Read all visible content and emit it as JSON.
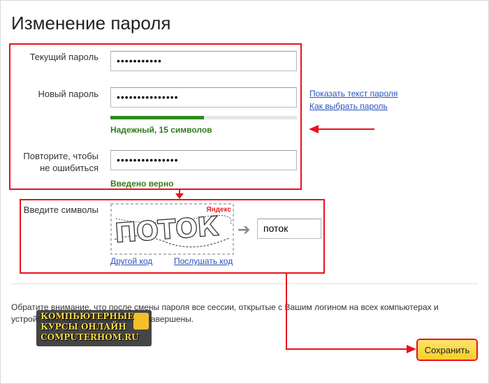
{
  "page": {
    "title": "Изменение пароля"
  },
  "form": {
    "current_password": {
      "label": "Текущий пароль",
      "value": "•••••••••••"
    },
    "new_password": {
      "label": "Новый пароль",
      "value": "•••••••••••••••"
    },
    "strength": {
      "level": 0.5,
      "text": "Надежный, 15 символов"
    },
    "repeat_password": {
      "label": "Повторите, чтобы не ошибиться",
      "value": "•••••••••••••••",
      "status": "Введено верно"
    }
  },
  "side_links": {
    "show_password": "Показать текст пароля",
    "how_to_choose": "Как выбрать пароль"
  },
  "captcha": {
    "label": "Введите символы",
    "image_word": "ПОТОК",
    "brand": "Яндекс",
    "input_value": "поток",
    "other_code": "Другой код",
    "listen_code": "Послушать код"
  },
  "notice": "Обратите внимание, что после смены пароля все сессии, открытые с Вашим логином на всех компьютерах и устройствах, будут автоматически завершены.",
  "actions": {
    "save_label": "Сохранить"
  },
  "watermark": {
    "line1": "КОМПЬЮТЕРНЫЕ",
    "line2": "КУРСЫ ОНЛАЙН",
    "line3": "COMPUTERHOM.RU"
  },
  "colors": {
    "annotation_red": "#e8121e",
    "success_green": "#2f7d1b",
    "link_blue": "#2a52be",
    "button_yellow": "#f7cf2a"
  }
}
